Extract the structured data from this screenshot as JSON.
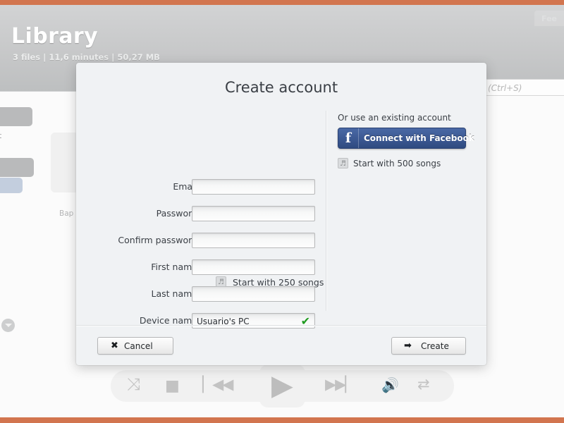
{
  "window": {
    "chrome_color": "#d2754f"
  },
  "background_app": {
    "header": {
      "title": "Library",
      "subtitle": "3 files | 11,6 minutes | 50,27 MB",
      "feedback_button": "Fee"
    },
    "search": {
      "placeholder": "(Ctrl+S)"
    },
    "sidebar": {
      "ghost_label": "t",
      "album_label": "Bap"
    },
    "player": {
      "shuffle_icon": "shuffle-icon",
      "stop_icon": "stop-icon",
      "previous_icon": "previous-track-icon",
      "play_icon": "play-icon",
      "next_icon": "next-track-icon",
      "volume_icon": "volume-icon",
      "repeat_icon": "repeat-icon",
      "glyphs": {
        "shuffle": "⤨",
        "stop": "■",
        "previous": "▏◀◀",
        "play": "▶",
        "next": "▶▶▏",
        "volume": "ὐA",
        "repeat": "⇄"
      }
    }
  },
  "dialog": {
    "title": "Create account",
    "fields": [
      {
        "label": "Email",
        "value": "",
        "name": "email",
        "checked": false
      },
      {
        "label": "Password",
        "value": "",
        "name": "password",
        "checked": false
      },
      {
        "label": "Confirm password",
        "value": "",
        "name": "confirm-password",
        "checked": false
      },
      {
        "label": "First name",
        "value": "",
        "name": "first-name",
        "checked": false
      },
      {
        "label": "Last name",
        "value": "",
        "name": "last-name",
        "checked": false
      },
      {
        "label": "Device name",
        "value": "Usuario's PC",
        "name": "device-name",
        "checked": true,
        "check_glyph": "✔"
      }
    ],
    "left_songs_link": "Start with 250 songs",
    "right": {
      "existing_account_label": "Or use an existing account",
      "facebook_button": "Connect with Facebook",
      "facebook_mark": "f",
      "songs_link": "Start with 500 songs"
    },
    "buttons": {
      "cancel": "Cancel",
      "cancel_glyph": "✖",
      "create": "Create",
      "create_glyph": "➡"
    },
    "colors": {
      "dialog_bg": "#f0f2f4",
      "facebook_blue": "#3b5892",
      "check_green": "#1f9b1f",
      "accent_orange": "#d2754f"
    }
  }
}
